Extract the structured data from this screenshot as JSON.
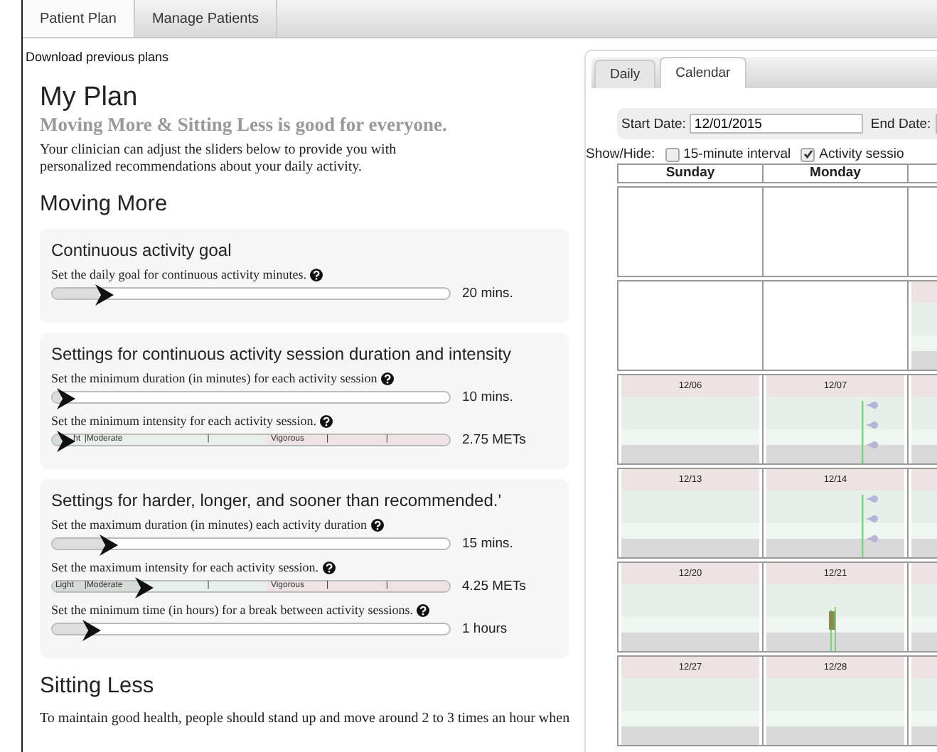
{
  "top_tabs": [
    {
      "label": "Patient Plan",
      "selected": true
    },
    {
      "label": "Manage Patients",
      "selected": false
    }
  ],
  "download_link": "Download previous plans",
  "plan": {
    "title": "My Plan",
    "subtitle": "Moving More & Sitting Less is good for everyone.",
    "description": "Your clinician can adjust the sliders below to provide you with personalized recommendations about your daily activity."
  },
  "moving_more": {
    "heading": "Moving More",
    "cards": [
      {
        "title": "Continuous activity goal",
        "sliders": [
          {
            "kind": "plain",
            "label": "Set the daily goal for continuous activity minutes.",
            "level": 0.12,
            "reading": "20 mins."
          }
        ]
      },
      {
        "title": "Settings for continuous activity session duration and intensity",
        "sliders": [
          {
            "kind": "plain",
            "label": "Set the minimum duration (in minutes) for each activity session",
            "level": 0.02,
            "reading": "10 mins."
          },
          {
            "kind": "intensity",
            "label": "Set the minimum intensity for each activity session.",
            "level": 0.02,
            "reading": "2.75 METs",
            "scale": [
              "ht",
              "|Moderate",
              "|",
              "Vigorous",
              "|",
              "|"
            ]
          }
        ]
      },
      {
        "title": "Settings for harder, longer, and sooner than recommended.'",
        "sliders": [
          {
            "kind": "plain",
            "label": "Set the maximum duration (in minutes) each activity duration",
            "level": 0.13,
            "reading": "15 mins."
          },
          {
            "kind": "intensity",
            "label": "Set the maximum intensity for each activity session.",
            "level": 0.22,
            "reading": "4.25 METs",
            "scale": [
              "Light",
              "|Moderate",
              "|",
              "Vigorous",
              "|",
              "|"
            ]
          },
          {
            "kind": "plain",
            "label": "Set the minimum time (in hours) for a break between activity sessions.",
            "level": 0.085,
            "reading": "1 hours"
          }
        ]
      }
    ]
  },
  "sitting_less": {
    "heading": "Sitting Less",
    "text": "To maintain good health, people should stand up and move around 2 to 3 times an hour when"
  },
  "panel": {
    "tabs": [
      {
        "label": "Daily",
        "selected": false
      },
      {
        "label": "Calendar",
        "selected": true
      }
    ],
    "start_date": {
      "label": "Start Date:",
      "value": "12/01/2015"
    },
    "end_date": {
      "label": "End Date:"
    },
    "show_hide": {
      "label": "Show/Hide:",
      "options": [
        {
          "label": "15-minute interval",
          "checked": false
        },
        {
          "label": "Activity sessio",
          "checked": true
        }
      ]
    },
    "calendar": {
      "days": [
        "Sunday",
        "Monday"
      ],
      "weeks": [
        [
          {
            "banded": false
          },
          {
            "banded": false
          },
          {
            "banded": false
          }
        ],
        [
          {
            "banded": false
          },
          {
            "banded": false
          },
          {
            "banded": true
          }
        ],
        [
          {
            "banded": true,
            "date": "12/06"
          },
          {
            "banded": true,
            "date": "12/07",
            "kind": "sessions"
          },
          {
            "banded": true
          }
        ],
        [
          {
            "banded": true,
            "date": "12/13"
          },
          {
            "banded": true,
            "date": "12/14",
            "kind": "sessions"
          },
          {
            "banded": true
          }
        ],
        [
          {
            "banded": true,
            "date": "12/20"
          },
          {
            "banded": true,
            "date": "12/21",
            "kind": "bar"
          },
          {
            "banded": true
          }
        ],
        [
          {
            "banded": true,
            "date": "12/27"
          },
          {
            "banded": true,
            "date": "12/28"
          },
          {
            "banded": true
          }
        ]
      ]
    }
  }
}
